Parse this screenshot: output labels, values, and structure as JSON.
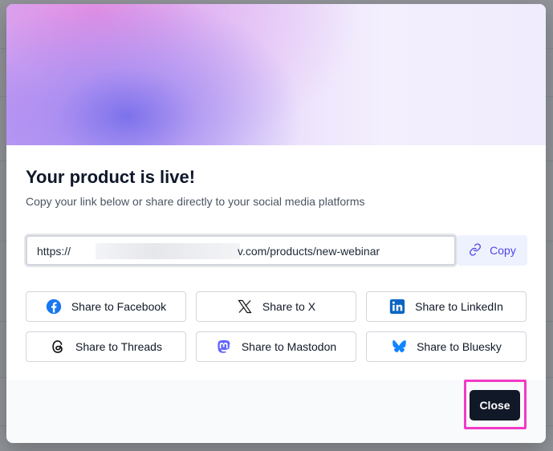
{
  "modal": {
    "title": "Your product is live!",
    "subtitle": "Copy your link below or share directly to your social media platforms",
    "url_prefix": "https://",
    "url_suffix": "v.com/products/new-webinar",
    "copy_label": "Copy",
    "share_buttons": [
      {
        "label": "Share to Facebook",
        "icon": "facebook-icon"
      },
      {
        "label": "Share to X",
        "icon": "x-icon"
      },
      {
        "label": "Share to LinkedIn",
        "icon": "linkedin-icon"
      },
      {
        "label": "Share to Threads",
        "icon": "threads-icon"
      },
      {
        "label": "Share to Mastodon",
        "icon": "mastodon-icon"
      },
      {
        "label": "Share to Bluesky",
        "icon": "bluesky-icon"
      }
    ],
    "close_label": "Close"
  },
  "colors": {
    "accent": "#4f46e5",
    "copy_bg": "#eef2ff",
    "close_bg": "#111827",
    "highlight": "#f13ac7",
    "facebook": "#1877f2",
    "linkedin": "#0a66c2",
    "mastodon": "#6364ff",
    "bluesky": "#1185fe"
  }
}
